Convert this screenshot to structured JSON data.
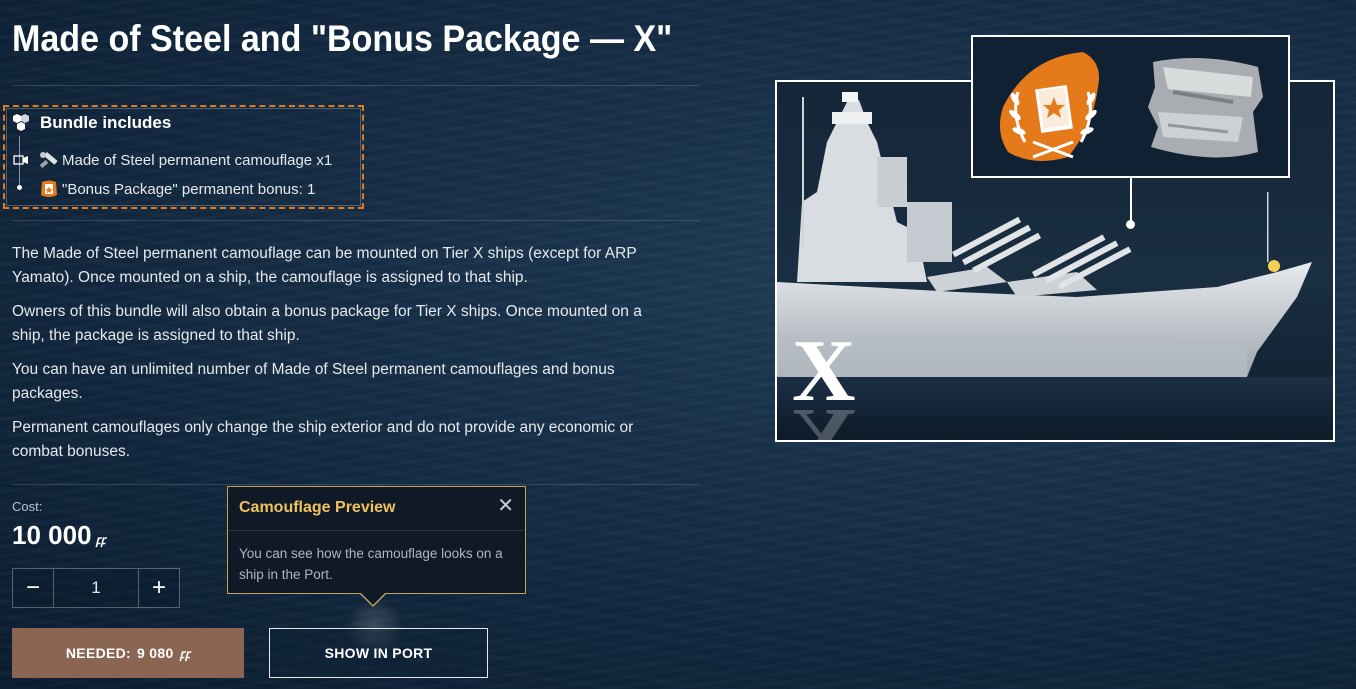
{
  "title": "Made of Steel and \"Bonus Package — X\"",
  "bundle": {
    "heading": "Bundle includes",
    "items": [
      {
        "label": "Made of Steel permanent camouflage x1",
        "icon": "camouflage-icon"
      },
      {
        "label": "\"Bonus Package\" permanent bonus: 1",
        "icon": "bonus-package-icon"
      }
    ]
  },
  "description": [
    "The Made of Steel permanent camouflage can be mounted on Tier X ships (except for ARP Yamato). Once mounted on a ship, the camouflage is assigned to that ship.",
    "Owners of this bundle will also obtain a bonus package for Tier X ships. Once mounted on a ship, the package is assigned to that ship.",
    "You can have an unlimited number of Made of Steel permanent camouflages and bonus packages.",
    "Permanent camouflages only change the ship exterior and do not provide any economic or combat bonuses."
  ],
  "cost": {
    "label": "Cost:",
    "value": "10 000",
    "currency_symbol": "ꝼꝼ"
  },
  "quantity": {
    "value": "1",
    "decrement": "−",
    "increment": "+"
  },
  "buttons": {
    "needed_label": "NEEDED:",
    "needed_value": "9 080",
    "needed_currency": "ꝼꝼ",
    "show_in_port": "SHOW IN PORT"
  },
  "tooltip": {
    "title": "Camouflage Preview",
    "close": "✕",
    "body": "You can see how the camouflage looks on a ship in the Port."
  },
  "preview": {
    "tier_label": "X"
  },
  "colors": {
    "accent_orange": "#e47a1a",
    "tooltip_title": "#f1c15f",
    "tooltip_border": "#c7a25a",
    "needed_button_bg": "#8a6552"
  }
}
